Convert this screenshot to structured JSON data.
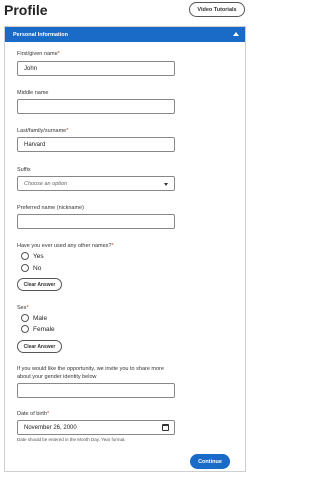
{
  "header": {
    "title": "Profile",
    "video_tutorials": "Video Tutorials"
  },
  "section": {
    "title": "Personal Information"
  },
  "fields": {
    "first_name": {
      "label": "First/given name",
      "required": "*",
      "value": "John"
    },
    "middle_name": {
      "label": "Middle name",
      "value": ""
    },
    "last_name": {
      "label": "Last/family/surname",
      "required": "*",
      "value": "Harvard"
    },
    "suffix": {
      "label": "Suffix",
      "placeholder": "Choose an option"
    },
    "preferred_name": {
      "label": "Preferred name (nickname)",
      "value": ""
    },
    "other_names": {
      "label": "Have you ever used any other names?",
      "required": "*",
      "options": [
        "Yes",
        "No"
      ],
      "clear": "Clear Answer"
    },
    "sex": {
      "label": "Sex",
      "required": "*",
      "options": [
        "Male",
        "Female"
      ],
      "clear": "Clear Answer"
    },
    "gender_identity": {
      "label_line1": "If you would like the opportunity, we invite you to share more",
      "label_line2": "about your gender identity below",
      "value": ""
    },
    "dob": {
      "label": "Date of birth",
      "required": "*",
      "value": "November 26, 2000",
      "hint": "Date should be entered in the Month Day, Year format."
    }
  },
  "actions": {
    "continue": "Continue"
  }
}
